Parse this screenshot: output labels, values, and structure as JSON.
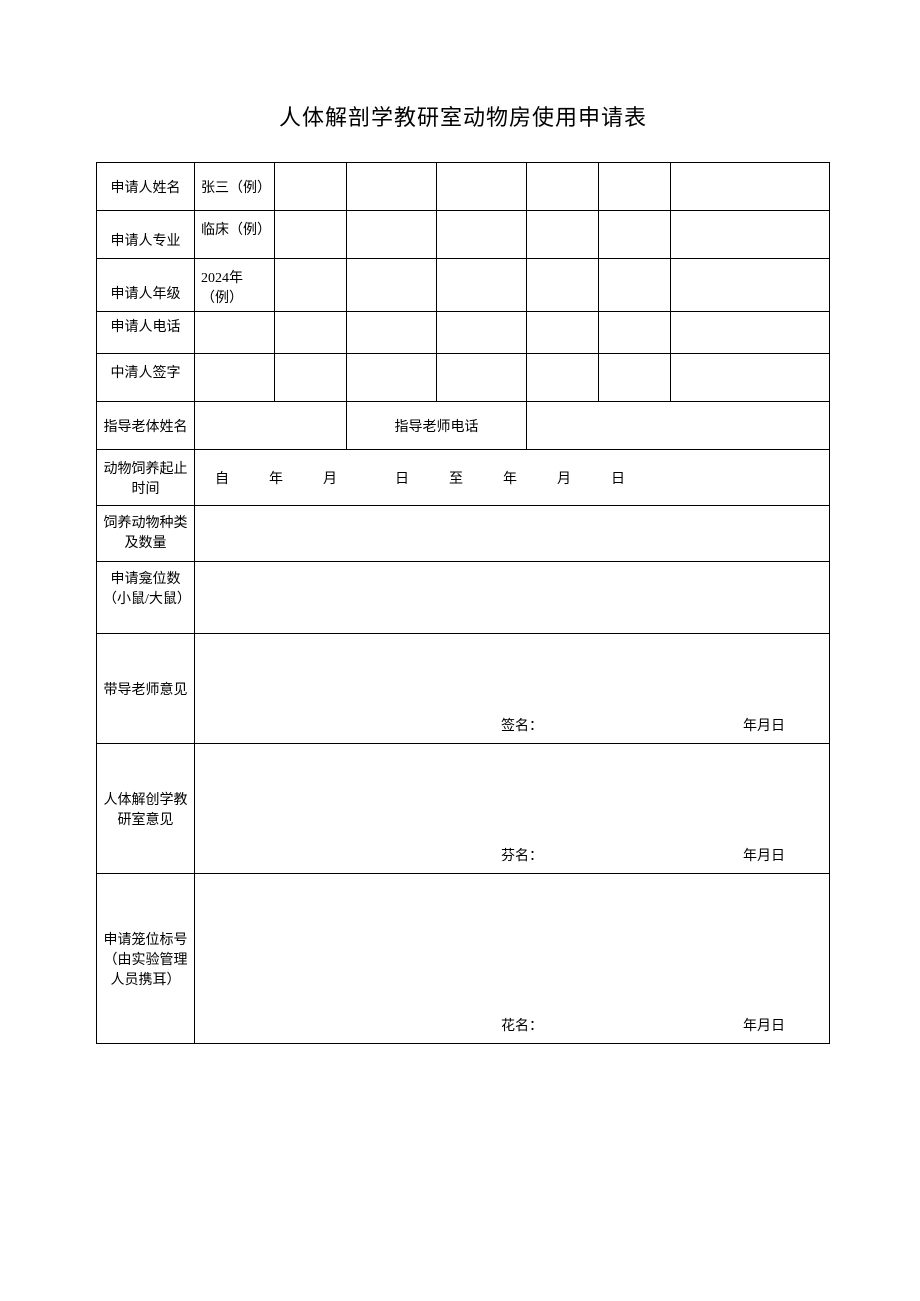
{
  "title": "人体解剖学教研室动物房使用申请表",
  "rows": {
    "name_label": "申请人姓名",
    "name_value": "张三（例）",
    "major_label": "申请人专业",
    "major_value": "临床（例）",
    "grade_label": "申请人年级",
    "grade_value": "2024年（例）",
    "phone_label": "申请人电话",
    "sign_label": "中清人签字",
    "advisor_name_label": "指导老体姓名",
    "advisor_phone_label": "指导老师电话",
    "period_label": "动物饲养起止时间",
    "period_value": "自　　年　　月　　　日　　至　　年　　月　　日",
    "species_label": "饲养动物种类及数量",
    "cage_count_label": "申请龛位数（小鼠/大鼠）",
    "advisor_opinion_label": "带导老师意见",
    "dept_opinion_label": "人体解创学教研室意见",
    "cage_id_label": "申请笼位标号（由实验管理人员携耳）",
    "sig1": "签名：",
    "sig2": "芬名：",
    "sig3": "花名：",
    "date_text": "年月日"
  }
}
